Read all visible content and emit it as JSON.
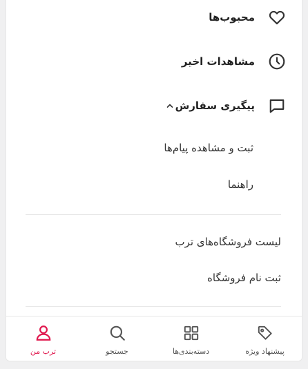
{
  "menu": {
    "favorites_label": "محبوب‌ها",
    "recent_views_label": "مشاهدات اخیر",
    "order_tracking_label": "پیگیری سفارش",
    "order_tracking_items": [
      {
        "label": "ثبت و مشاهده پیام‌ها"
      },
      {
        "label": "راهنما"
      }
    ],
    "links": [
      {
        "label": "لیست فروشگاه‌های ترب"
      },
      {
        "label": "ثبت نام فروشگاه"
      }
    ]
  },
  "bottom_nav": {
    "tabs": [
      {
        "label": "پیشنهاد ویژه",
        "icon": "tag-icon"
      },
      {
        "label": "دسته‌بندی‌ها",
        "icon": "grid-icon"
      },
      {
        "label": "جستجو",
        "icon": "search-icon"
      },
      {
        "label": "ترب من",
        "icon": "user-icon",
        "active": true
      }
    ]
  },
  "colors": {
    "accent": "#e0174d",
    "text": "#222222",
    "icon": "#333333",
    "nav_icon": "#555555"
  }
}
